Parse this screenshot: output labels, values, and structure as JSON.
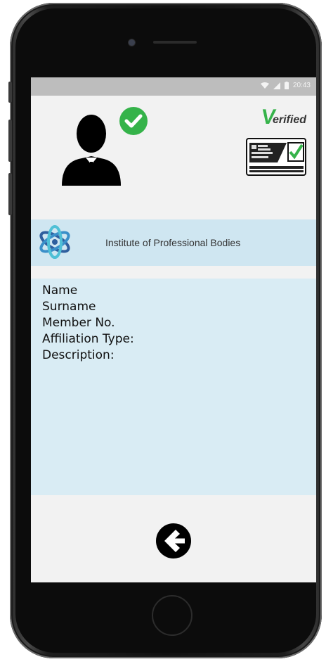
{
  "status_bar": {
    "time": "20:43",
    "icons": [
      "wifi-icon",
      "signal-icon",
      "battery-icon"
    ]
  },
  "profile": {
    "avatar_icon": "user-avatar-icon",
    "badge_icon": "check-circle-icon",
    "badge_color": "#35b34a"
  },
  "verified": {
    "v_letter": "V",
    "rest_text": "erified",
    "v_color": "#35b34a"
  },
  "card_icon": "id-card-check-icon",
  "institute": {
    "name": "Institute of Professional Bodies",
    "logo_icon": "atom-logo-icon",
    "bar_color": "#cfe6f1"
  },
  "fields": [
    "Name",
    "Surname",
    "Member No.",
    "Affiliation Type:",
    "Description:"
  ],
  "navigation": {
    "back_icon": "arrow-left-circle-icon"
  }
}
